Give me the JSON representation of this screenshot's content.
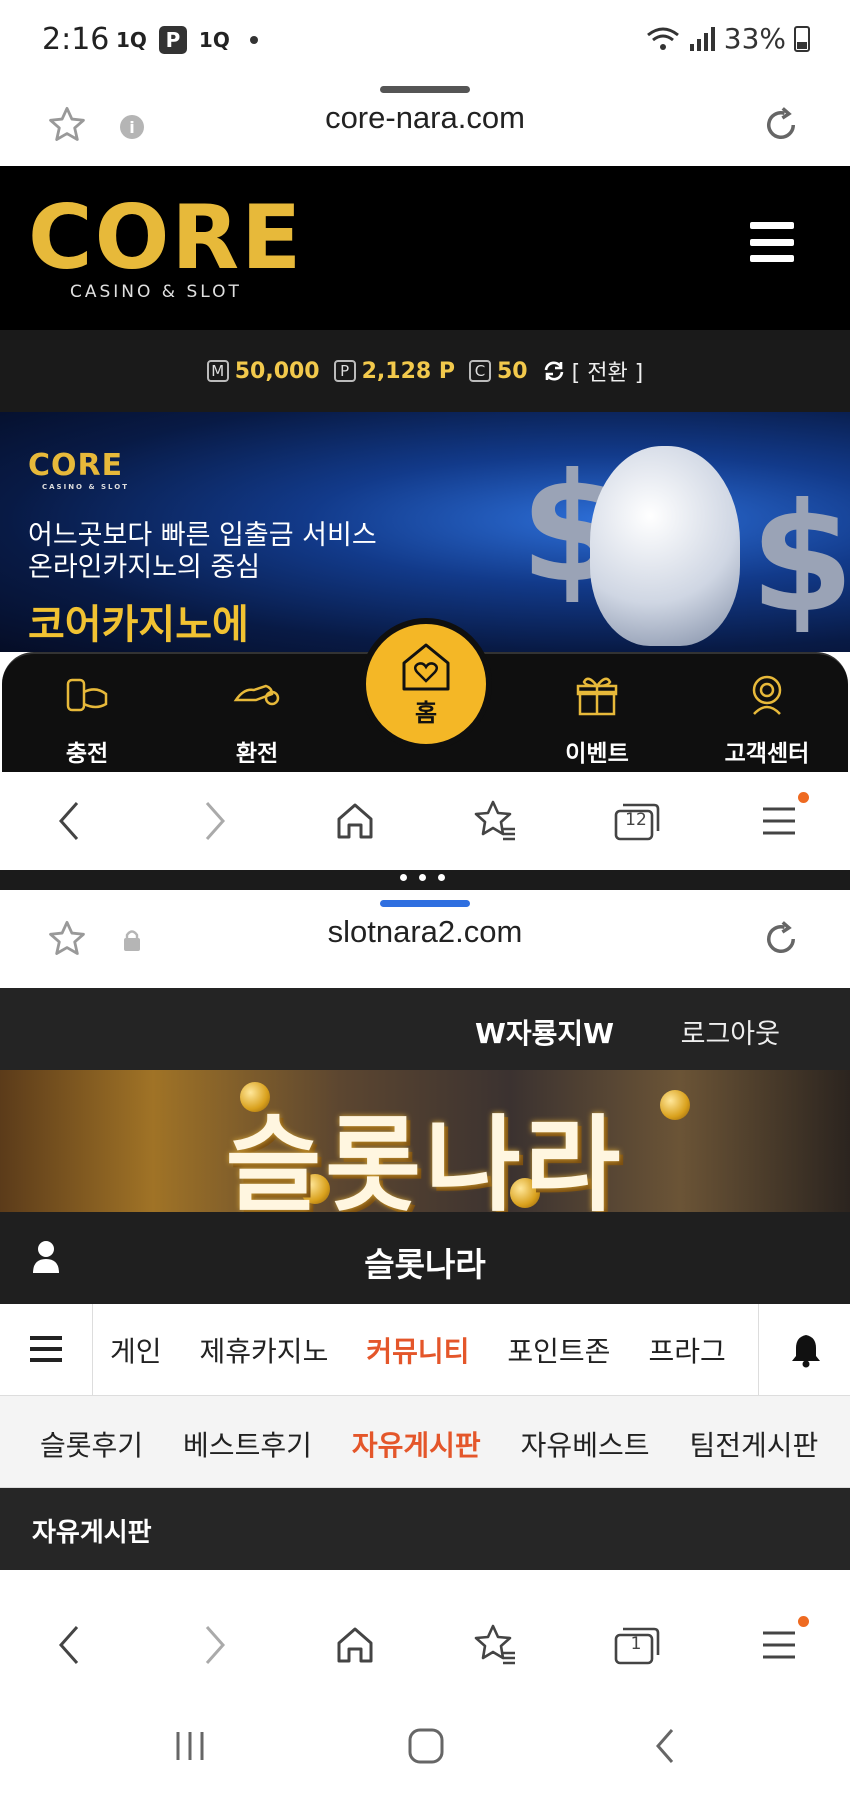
{
  "status_bar": {
    "time": "2:16",
    "notif_icons": [
      "1Q",
      "P",
      "1Q"
    ],
    "battery": "33%"
  },
  "top_browser": {
    "url": "core-nara.com",
    "info_icon": "i"
  },
  "core": {
    "logo_word": "CORE",
    "logo_tag": "CASINO & SLOT",
    "balance": {
      "money_icon": "M",
      "money": "50,000",
      "point_icon": "P",
      "point": "2,128 P",
      "coin_icon": "C",
      "coin": "50",
      "switch": "[ 전환 ]"
    },
    "banner": {
      "logo": "CORE",
      "logo_small": "CASINO & SLOT",
      "line1": "어느곳보다 빠른 입출금 서비스",
      "line2": "온라인카지노의 중심",
      "headline": "코어카지노에"
    },
    "nav": {
      "charge": "충전",
      "exchange": "환전",
      "home": "홈",
      "event": "이벤트",
      "support": "고객센터"
    }
  },
  "top_toolbar": {
    "tabs_count": "12"
  },
  "bottom_browser": {
    "url": "slotnara2.com"
  },
  "slotnara": {
    "user": "W자룡지W",
    "logout": "로그아웃",
    "banner_title": "슬롯나라",
    "site_title": "슬롯나라",
    "menu": [
      "게인",
      "제휴카지노",
      "커뮤니티",
      "포인트존",
      "프라그"
    ],
    "menu_active": "커뮤니티",
    "submenu": [
      "슬롯후기",
      "베스트후기",
      "자유게시판",
      "자유베스트",
      "팀전게시판"
    ],
    "submenu_active": "자유게시판",
    "board_title": "자유게시판"
  },
  "bottom_toolbar": {
    "tabs_count": "1"
  },
  "colors": {
    "gold": "#f4b726",
    "accent_orange": "#e4562a",
    "browser_badge": "#ee6a21"
  }
}
